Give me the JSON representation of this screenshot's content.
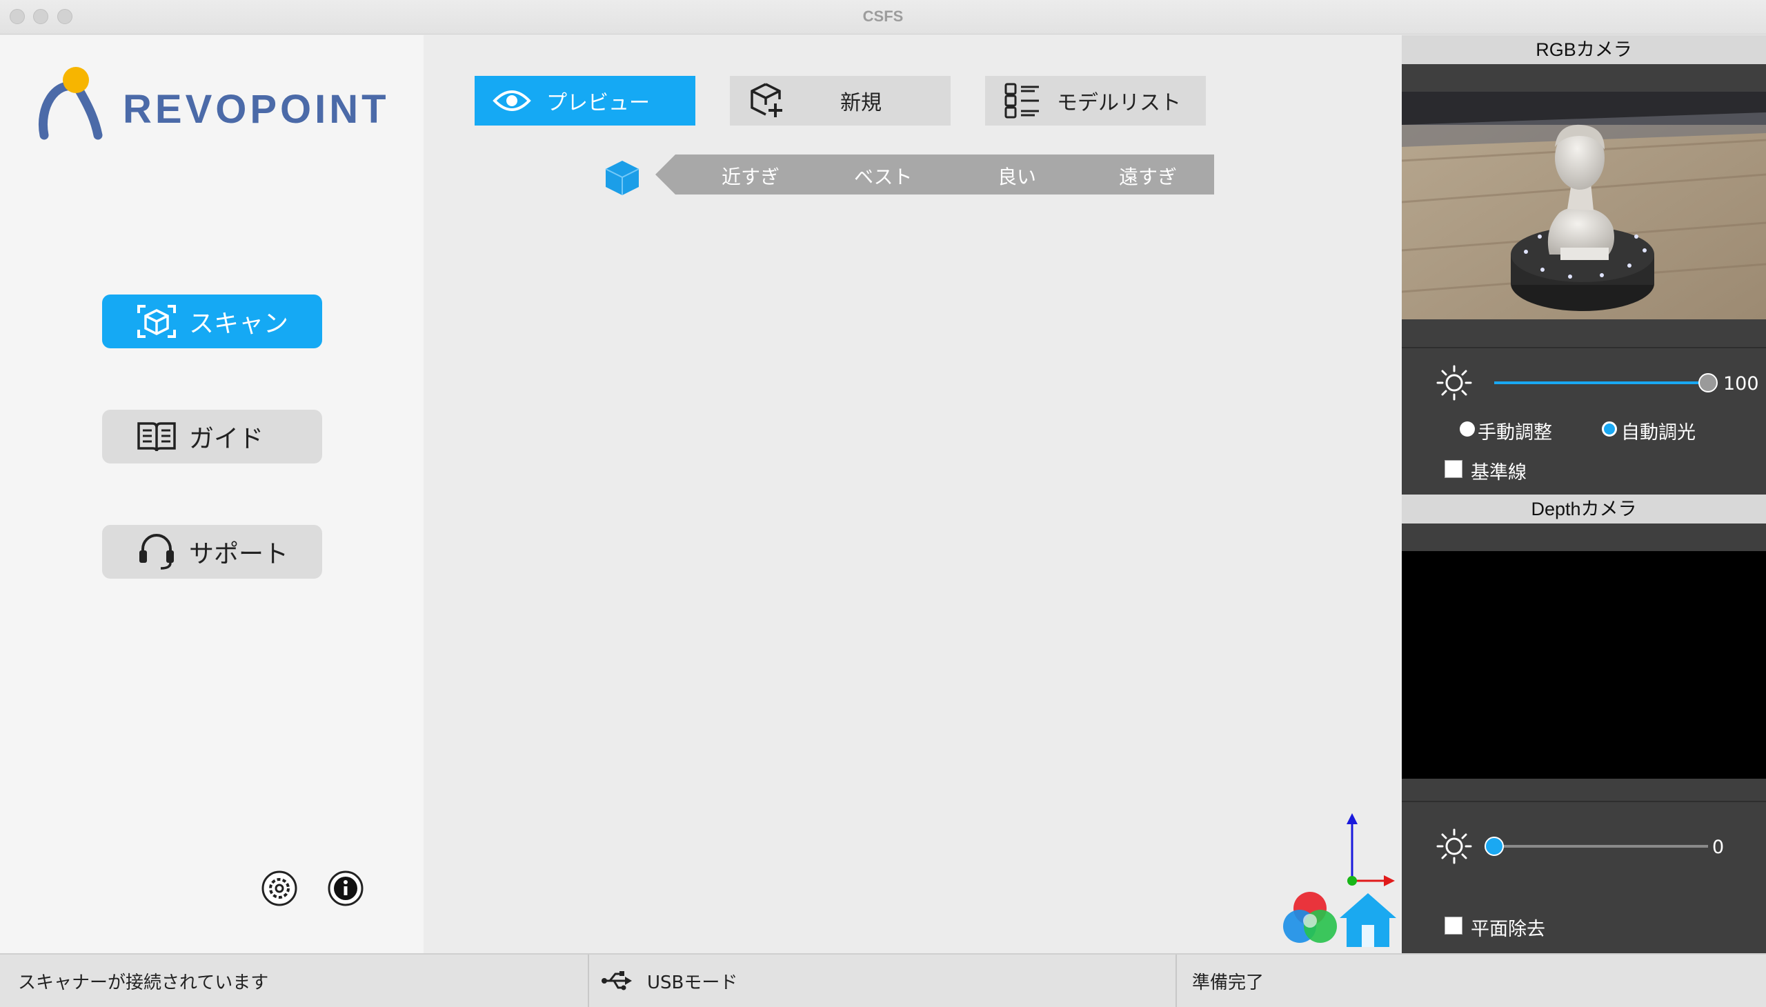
{
  "window": {
    "title": "CSFS"
  },
  "sidebar": {
    "logo_text": "REVOPOINT",
    "buttons": [
      {
        "label": "スキャン",
        "icon": "scan-cube-icon",
        "active": true
      },
      {
        "label": "ガイド",
        "icon": "book-icon",
        "active": false
      },
      {
        "label": "サポート",
        "icon": "headset-icon",
        "active": false
      }
    ],
    "settings_icon": "gear-icon",
    "info_icon": "info-icon"
  },
  "toolbar": {
    "buttons": [
      {
        "label": "プレビュー",
        "icon": "eye-icon",
        "active": true
      },
      {
        "label": "新規",
        "icon": "new-box-icon",
        "active": false
      },
      {
        "label": "モデルリスト",
        "icon": "list-icon",
        "active": false
      }
    ]
  },
  "distance": {
    "icon": "cube-icon",
    "labels": [
      "近すぎ",
      "ベスト",
      "良い",
      "遠すぎ"
    ]
  },
  "rgb_camera": {
    "title": "RGBカメラ",
    "brightness_value": "100",
    "brightness_level": 1.0,
    "manual_label": "手動調整",
    "auto_label": "自動調光",
    "baseline_label": "基準線"
  },
  "depth_camera": {
    "title": "Depthカメラ",
    "brightness_value": "0",
    "brightness_level": 0.0,
    "plane_removal_label": "平面除去"
  },
  "status": {
    "connection": "スキャナーが接続されています",
    "mode": "USBモード",
    "state": "準備完了"
  },
  "colors": {
    "accent": "#15a9f4",
    "logo": "#4b6aa8"
  }
}
